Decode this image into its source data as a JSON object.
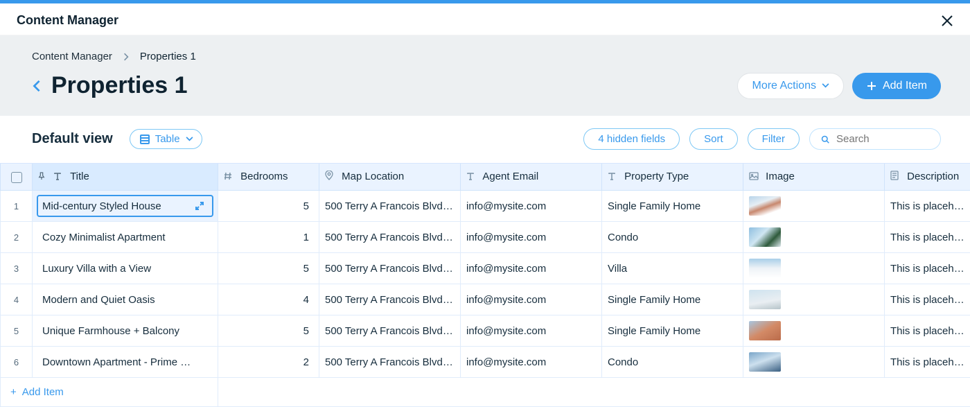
{
  "panel_title": "Content Manager",
  "breadcrumb": {
    "root": "Content Manager",
    "current": "Properties 1"
  },
  "page_title": "Properties 1",
  "actions": {
    "more": "More Actions",
    "add": "Add Item"
  },
  "view": {
    "name": "Default view",
    "picker": "Table"
  },
  "toolbar": {
    "hidden": "4 hidden fields",
    "sort": "Sort",
    "filter": "Filter",
    "search_placeholder": "Search"
  },
  "columns": {
    "title": "Title",
    "bedrooms": "Bedrooms",
    "map": "Map Location",
    "email": "Agent Email",
    "ptype": "Property Type",
    "image": "Image",
    "desc": "Description"
  },
  "rows": [
    {
      "n": "1",
      "title": "Mid-century Styled House",
      "bedrooms": "5",
      "map": "500 Terry A Francois Blvd,…",
      "email": "info@mysite.com",
      "ptype": "Single Family Home",
      "desc": "This is placeholde",
      "thumb": "linear-gradient(160deg,#b8d4ea 0%,#e6eef4 35%,#c8886e 55%,#ffffff 80%)"
    },
    {
      "n": "2",
      "title": "Cozy Minimalist Apartment",
      "bedrooms": "1",
      "map": "500 Terry A Francois Blvd,…",
      "email": "info@mysite.com",
      "ptype": "Condo",
      "desc": "This is placeholde",
      "thumb": "linear-gradient(135deg,#8fbfe0 0%,#cfe6f2 40%,#2e5a3b 70%,#dfe9ef 100%)"
    },
    {
      "n": "3",
      "title": "Luxury Villa with a View",
      "bedrooms": "5",
      "map": "500 Terry A Francois Blvd,…",
      "email": "info@mysite.com",
      "ptype": "Villa",
      "desc": "This is placeholde",
      "thumb": "linear-gradient(180deg,#a9cfe8 0%,#eef3f7 50%,#ffffff 100%)"
    },
    {
      "n": "4",
      "title": "Modern and Quiet Oasis",
      "bedrooms": "4",
      "map": "500 Terry A Francois Blvd,…",
      "email": "info@mysite.com",
      "ptype": "Single Family Home",
      "desc": "This is placeholde",
      "thumb": "linear-gradient(170deg,#cfe3ef 0%,#e9eef2 60%,#b6c4c9 100%)"
    },
    {
      "n": "5",
      "title": "Unique Farmhouse + Balcony",
      "bedrooms": "5",
      "map": "500 Terry A Francois Blvd,…",
      "email": "info@mysite.com",
      "ptype": "Single Family Home",
      "desc": "This is placeholde",
      "thumb": "linear-gradient(150deg,#a8c6e0 0%,#d38a66 50%,#ba6b4a 100%)"
    },
    {
      "n": "6",
      "title": "Downtown Apartment - Prime …",
      "bedrooms": "2",
      "map": "500 Terry A Francois Blvd,…",
      "email": "info@mysite.com",
      "ptype": "Condo",
      "desc": "This is placeholde",
      "thumb": "linear-gradient(160deg,#7aa6c9 0%,#cde0ee 45%,#3a5f82 100%)"
    }
  ],
  "footer_add": "Add Item"
}
